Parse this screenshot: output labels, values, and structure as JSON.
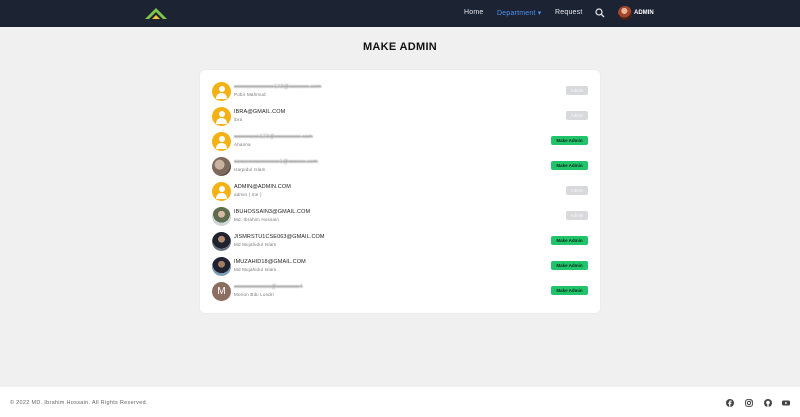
{
  "navbar": {
    "links": [
      "Home",
      "Department",
      "Request"
    ],
    "dropdown_caret": "▾",
    "user_name": "ADMIN"
  },
  "page": {
    "title": "MAKE ADMIN"
  },
  "users": [
    {
      "email": "xxxxxxxxxxxxxx123@xxxxxxx.com",
      "name": "Pobir Mahmud",
      "action": "Admin",
      "avatar": "default",
      "redacted": true
    },
    {
      "email": "ibra@gmail.com",
      "name": "ibra",
      "action": "Admin",
      "avatar": "default",
      "redacted": false
    },
    {
      "email": "xxxxxxxxx123@xxxxxxxxx.com",
      "name": "Ahanna",
      "action": "Make Admin",
      "avatar": "default",
      "redacted": true
    },
    {
      "email": "xxxxxxxxxxxxxxxx1@xxxxxx.com",
      "name": "Harpidul Islam",
      "action": "Make Admin",
      "avatar": "photo-a",
      "redacted": true
    },
    {
      "email": "admin@admin.com",
      "name": "admin ( me )",
      "action": "Admin",
      "avatar": "default",
      "redacted": false
    },
    {
      "email": "ibuhossain3@gmail.com",
      "name": "Md. Ibrahim Hossain",
      "action": "Admin",
      "avatar": "photo-b",
      "redacted": false
    },
    {
      "email": "jismrstu1cse063@gmail.com",
      "name": "Md Mujahidul Islam",
      "action": "Make Admin",
      "avatar": "photo-c",
      "redacted": false
    },
    {
      "email": "imuzahid18@gmail.com",
      "name": "Md Mujahidul Islam",
      "action": "Make Admin",
      "avatar": "photo-d",
      "redacted": false
    },
    {
      "email": "xxxxxxxxxxxxx@xxxxxxxx4",
      "name": "Morion Bibi Londri",
      "action": "Make Admin",
      "avatar": "letter",
      "avatar_letter": "M",
      "redacted": true
    }
  ],
  "footer": {
    "copyright": "© 2022 MD. Ibrahim Hossain. All Rights Reserved."
  },
  "social_icons": [
    "facebook-icon",
    "instagram-icon",
    "github-icon",
    "youtube-icon"
  ],
  "colors": {
    "navbar": "#1c2333",
    "active_link": "#4f8ff7",
    "make_admin_button": "#21c46b",
    "admin_button": "#d7d9dc",
    "default_avatar": "#f3b113"
  }
}
